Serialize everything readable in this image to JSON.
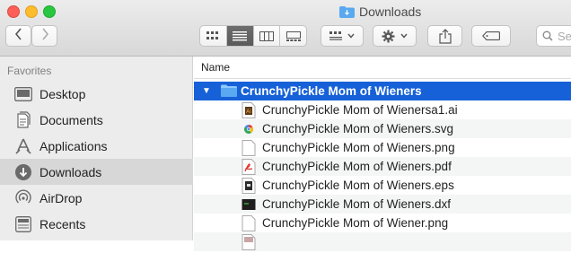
{
  "window": {
    "title": "Downloads"
  },
  "toolbar": {
    "back_icon": "chevron-left-icon",
    "forward_icon": "chevron-right-icon",
    "view_modes": [
      "icon-view",
      "list-view",
      "column-view",
      "gallery-view"
    ],
    "active_view": "list-view",
    "group_icon": "group-by-icon",
    "action_icon": "gear-icon",
    "share_icon": "share-icon",
    "tag_icon": "tag-icon",
    "search_placeholder": "Se"
  },
  "sidebar": {
    "heading": "Favorites",
    "items": [
      {
        "label": "Desktop",
        "icon": "desktop-icon",
        "selected": false
      },
      {
        "label": "Documents",
        "icon": "documents-icon",
        "selected": false
      },
      {
        "label": "Applications",
        "icon": "applications-icon",
        "selected": false
      },
      {
        "label": "Downloads",
        "icon": "downloads-icon",
        "selected": true
      },
      {
        "label": "AirDrop",
        "icon": "airdrop-icon",
        "selected": false
      },
      {
        "label": "Recents",
        "icon": "recents-icon",
        "selected": false
      }
    ]
  },
  "list": {
    "column_header": "Name",
    "folder": {
      "name": "CrunchyPickle Mom of Wieners",
      "expanded": true
    },
    "files": [
      {
        "name": "CrunchyPickle Mom of Wienersa1.ai",
        "icon": "ai-file-icon"
      },
      {
        "name": "CrunchyPickle Mom of Wieners.svg",
        "icon": "svg-file-icon"
      },
      {
        "name": "CrunchyPickle Mom of Wieners.png",
        "icon": "png-file-icon"
      },
      {
        "name": "CrunchyPickle Mom of Wieners.pdf",
        "icon": "pdf-file-icon"
      },
      {
        "name": "CrunchyPickle Mom of Wieners.eps",
        "icon": "eps-file-icon"
      },
      {
        "name": "CrunchyPickle Mom of Wieners.dxf",
        "icon": "dxf-file-icon"
      },
      {
        "name": "CrunchyPickle Mom of Wiener.png",
        "icon": "png-file-icon"
      }
    ]
  },
  "colors": {
    "selection": "#1661d8",
    "folder": "#5aa8f0",
    "sidebar_bg": "#ececec"
  }
}
